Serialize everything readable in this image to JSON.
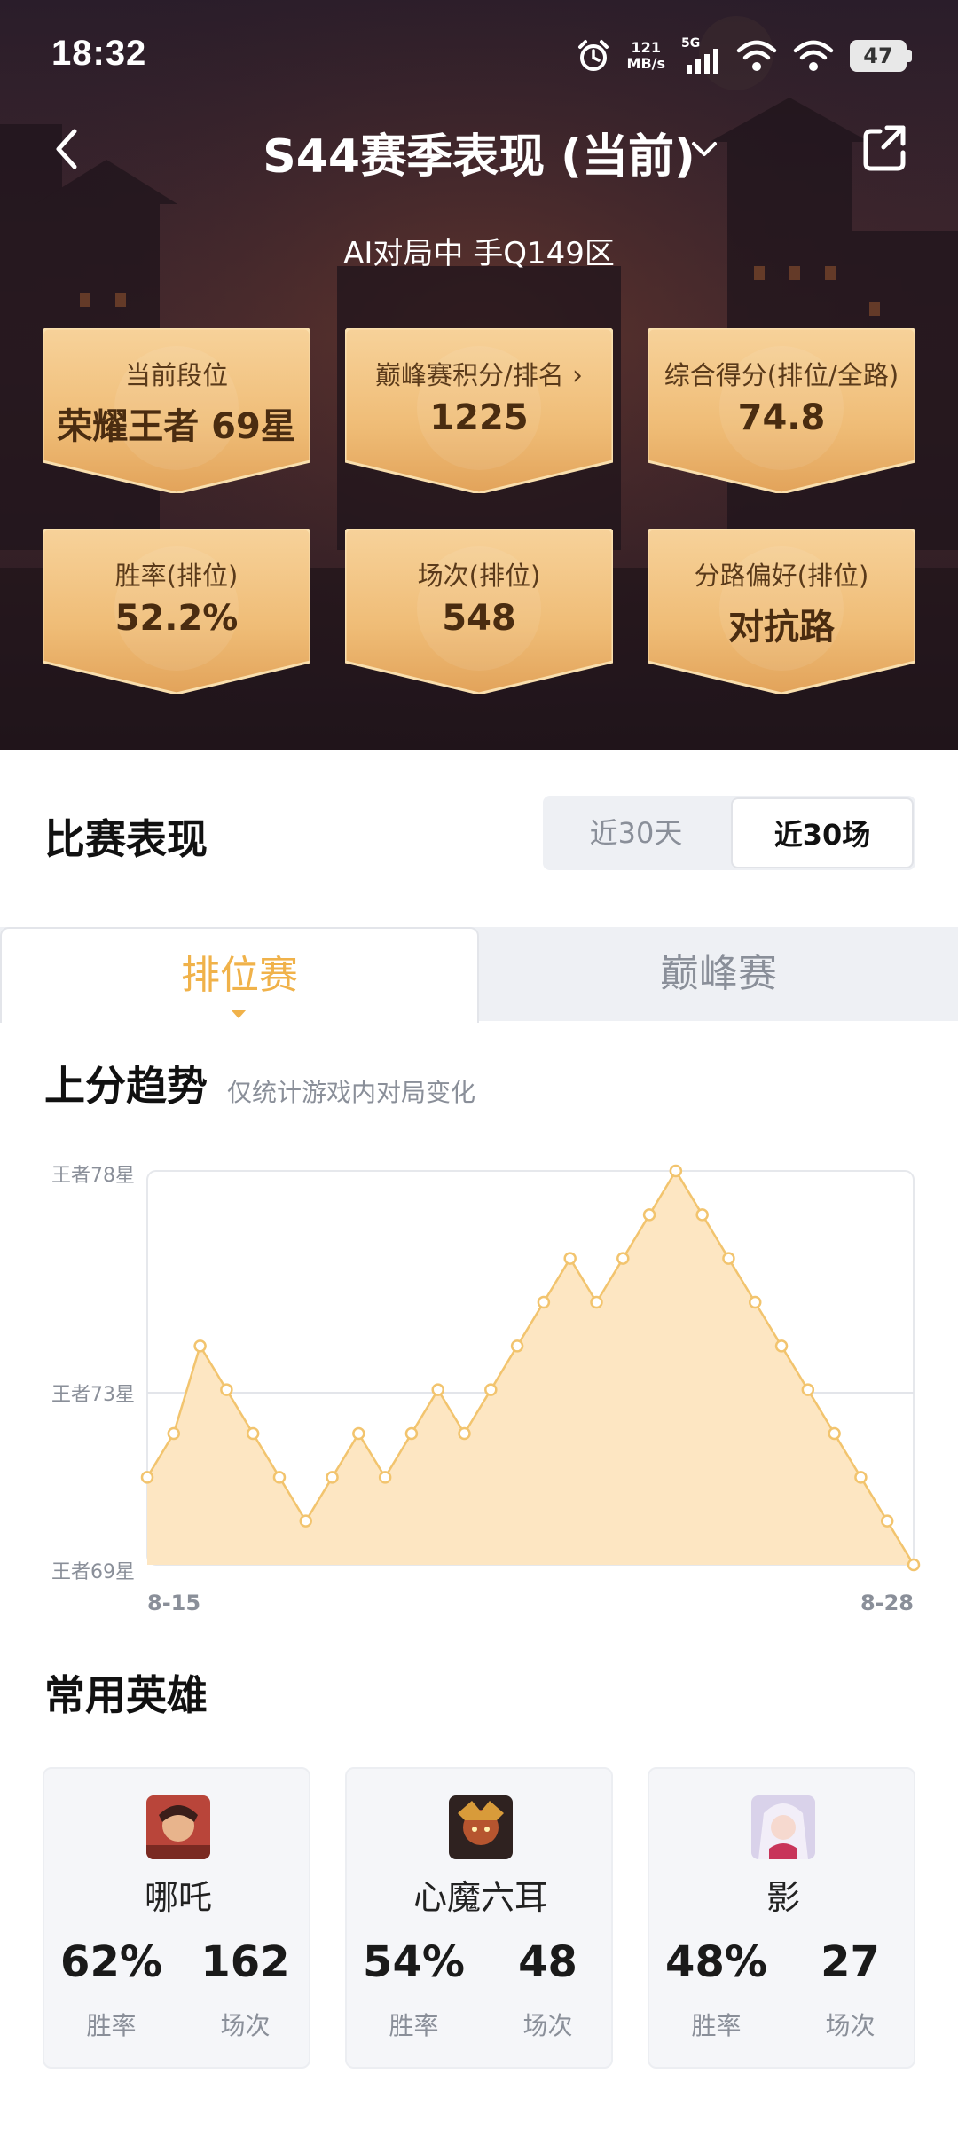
{
  "status": {
    "time": "18:32",
    "speed_value": "121",
    "speed_unit": "MB/s",
    "network": "5G",
    "battery": "47"
  },
  "header": {
    "title": "S44赛季表现 (当前)",
    "subtitle": "AI对局中  手Q149区"
  },
  "stats": [
    {
      "label": "当前段位",
      "value": "荣耀王者 69星"
    },
    {
      "label": "巅峰赛积分/排名",
      "value": "1225",
      "has_arrow": true
    },
    {
      "label": "综合得分(排位/全路)",
      "value": "74.8"
    },
    {
      "label": "胜率(排位)",
      "value": "52.2%"
    },
    {
      "label": "场次(排位)",
      "value": "548"
    },
    {
      "label": "分路偏好(排位)",
      "value": "对抗路"
    }
  ],
  "performance": {
    "title": "比赛表现",
    "seg_options": [
      "近30天",
      "近30场"
    ],
    "seg_selected": "近30场"
  },
  "mode_tabs": [
    "排位赛",
    "巅峰赛"
  ],
  "mode_selected": "排位赛",
  "trend": {
    "title": "上分趋势",
    "note": "仅统计游戏内对局变化"
  },
  "chart_data": {
    "type": "area",
    "y_tick_labels": [
      "王者78星",
      "王者73星",
      "王者69星"
    ],
    "x_start_label": "8-15",
    "x_end_label": "8-28",
    "ylim": [
      69,
      78
    ],
    "values": [
      71,
      72,
      74,
      73,
      72,
      71,
      70,
      71,
      72,
      71,
      72,
      73,
      72,
      73,
      74,
      75,
      76,
      75,
      76,
      77,
      78,
      77,
      76,
      75,
      74,
      73,
      72,
      71,
      70,
      69
    ],
    "grid": true,
    "fill_color": "#fde6c2",
    "line_color": "#f2c46e"
  },
  "heroes_section": {
    "title": "常用英雄"
  },
  "heroes": [
    {
      "name": "哪吒",
      "win_rate": "62%",
      "win_label": "胜率",
      "games": "162",
      "games_label": "场次"
    },
    {
      "name": "心魔六耳",
      "win_rate": "54%",
      "win_label": "胜率",
      "games": "48",
      "games_label": "场次"
    },
    {
      "name": "影",
      "win_rate": "48%",
      "win_label": "胜率",
      "games": "27",
      "games_label": "场次"
    }
  ],
  "colors": {
    "accent": "#f0b24a",
    "card_gold": "#f1c27d",
    "text_dark": "#111111",
    "muted": "#8a8f99"
  }
}
